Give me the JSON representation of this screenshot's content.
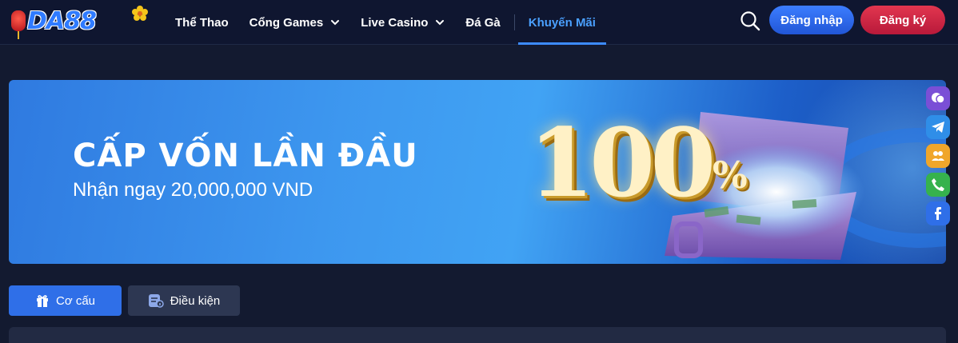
{
  "header": {
    "logo_text": "DA88",
    "nav": [
      {
        "label": "Thể Thao",
        "has_dropdown": false,
        "active": false
      },
      {
        "label": "Cổng Games",
        "has_dropdown": true,
        "active": false
      },
      {
        "label": "Live Casino",
        "has_dropdown": true,
        "active": false
      },
      {
        "label": "Đá Gà",
        "has_dropdown": false,
        "active": false
      },
      {
        "label": "Khuyến Mãi",
        "has_dropdown": false,
        "active": true
      }
    ],
    "login_label": "Đăng nhập",
    "register_label": "Đăng ký"
  },
  "banner": {
    "title": "CẤP VỐN LẦN ĐẦU",
    "subtitle": "Nhận ngay 20,000,000 VND",
    "big_number": "100",
    "percent_sign": "%"
  },
  "socials": [
    "chat-icon",
    "telegram-icon",
    "support-icon",
    "phone-icon",
    "facebook-icon"
  ],
  "tabs": {
    "structure_label": "Cơ cấu",
    "conditions_label": "Điều kiện"
  },
  "colors": {
    "accent": "#3d8bff",
    "login": "#2f6ae6",
    "register": "#cf2445",
    "background": "#131a30"
  }
}
